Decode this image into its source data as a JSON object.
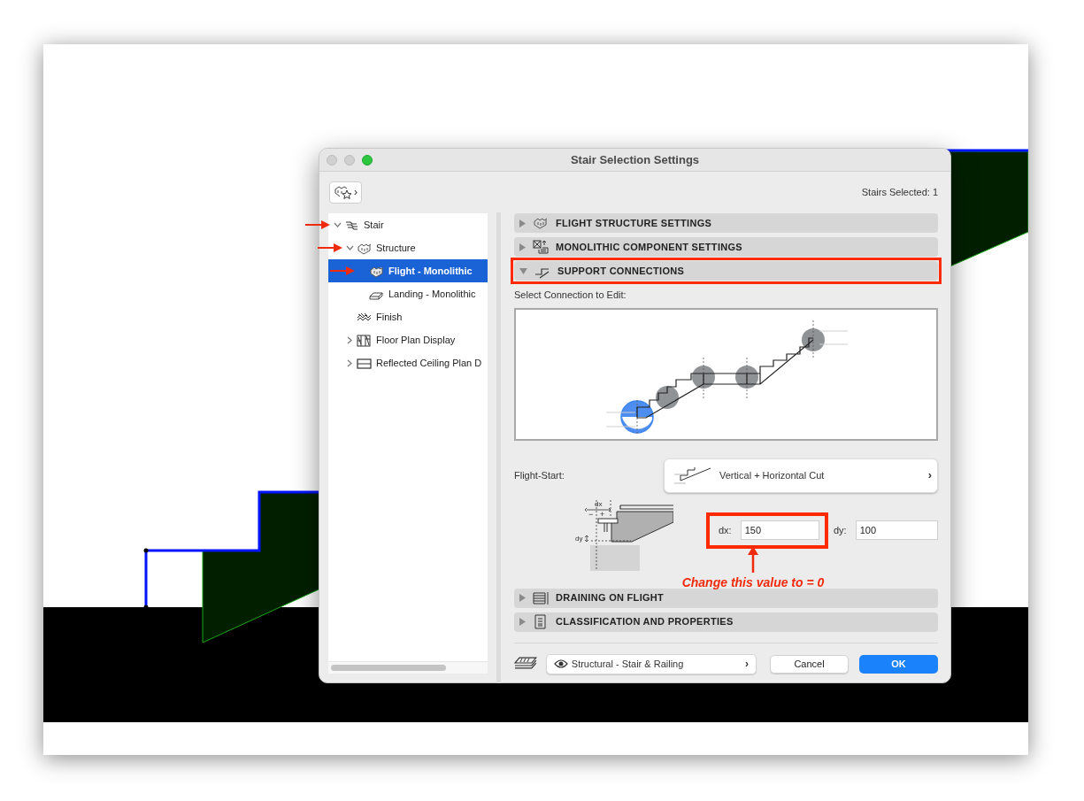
{
  "window": {
    "title": "Stair Selection Settings"
  },
  "toolbar": {
    "favorites_chevron": "›",
    "selection_count": "Stairs Selected: 1"
  },
  "tree": [
    {
      "label": "Stair",
      "expanded": true,
      "selected": false,
      "marked": true,
      "children": [
        {
          "label": "Structure",
          "expanded": true,
          "selected": false,
          "marked": true,
          "children": [
            {
              "label": "Flight - Monolithic",
              "selected": true,
              "marked": true
            },
            {
              "label": "Landing - Monolithic",
              "selected": false,
              "marked": false
            }
          ]
        },
        {
          "label": "Finish",
          "selected": false,
          "marked": false
        },
        {
          "label": "Floor Plan Display",
          "expanded": false,
          "selected": false,
          "marked": false
        },
        {
          "label": "Reflected Ceiling Plan D",
          "expanded": false,
          "selected": false,
          "marked": false
        }
      ]
    }
  ],
  "sections_top": [
    {
      "label": "FLIGHT STRUCTURE SETTINGS",
      "expanded": false,
      "highlighted": false
    },
    {
      "label": "MONOLITHIC COMPONENT SETTINGS",
      "expanded": false,
      "highlighted": false
    },
    {
      "label": "SUPPORT CONNECTIONS",
      "expanded": true,
      "highlighted": true
    }
  ],
  "support": {
    "prompt": "Select Connection to Edit:",
    "connections": [
      {
        "selected": true
      },
      {
        "selected": false
      },
      {
        "selected": false
      },
      {
        "selected": false
      },
      {
        "selected": false
      }
    ],
    "connection_label": "Flight-Start:",
    "connection_type": "Vertical + Horizontal Cut",
    "connection_chevron": "›",
    "diagram_labels": {
      "dx": "dx",
      "minus": "−",
      "plus": "+",
      "dy": "dy"
    },
    "dx": {
      "label": "dx:",
      "value": "150",
      "highlighted": true
    },
    "dy": {
      "label": "dy:",
      "value": "100"
    },
    "annotation": "Change this value to = 0"
  },
  "sections_bottom": [
    {
      "label": "DRAINING ON FLIGHT",
      "expanded": false,
      "highlighted": false
    },
    {
      "label": "CLASSIFICATION AND PROPERTIES",
      "expanded": false,
      "highlighted": false
    }
  ],
  "footer": {
    "view": "Structural - Stair & Railing",
    "view_chevron": "›",
    "buttons": [
      {
        "label": "Cancel",
        "default": false
      },
      {
        "label": "OK",
        "default": true
      }
    ]
  }
}
